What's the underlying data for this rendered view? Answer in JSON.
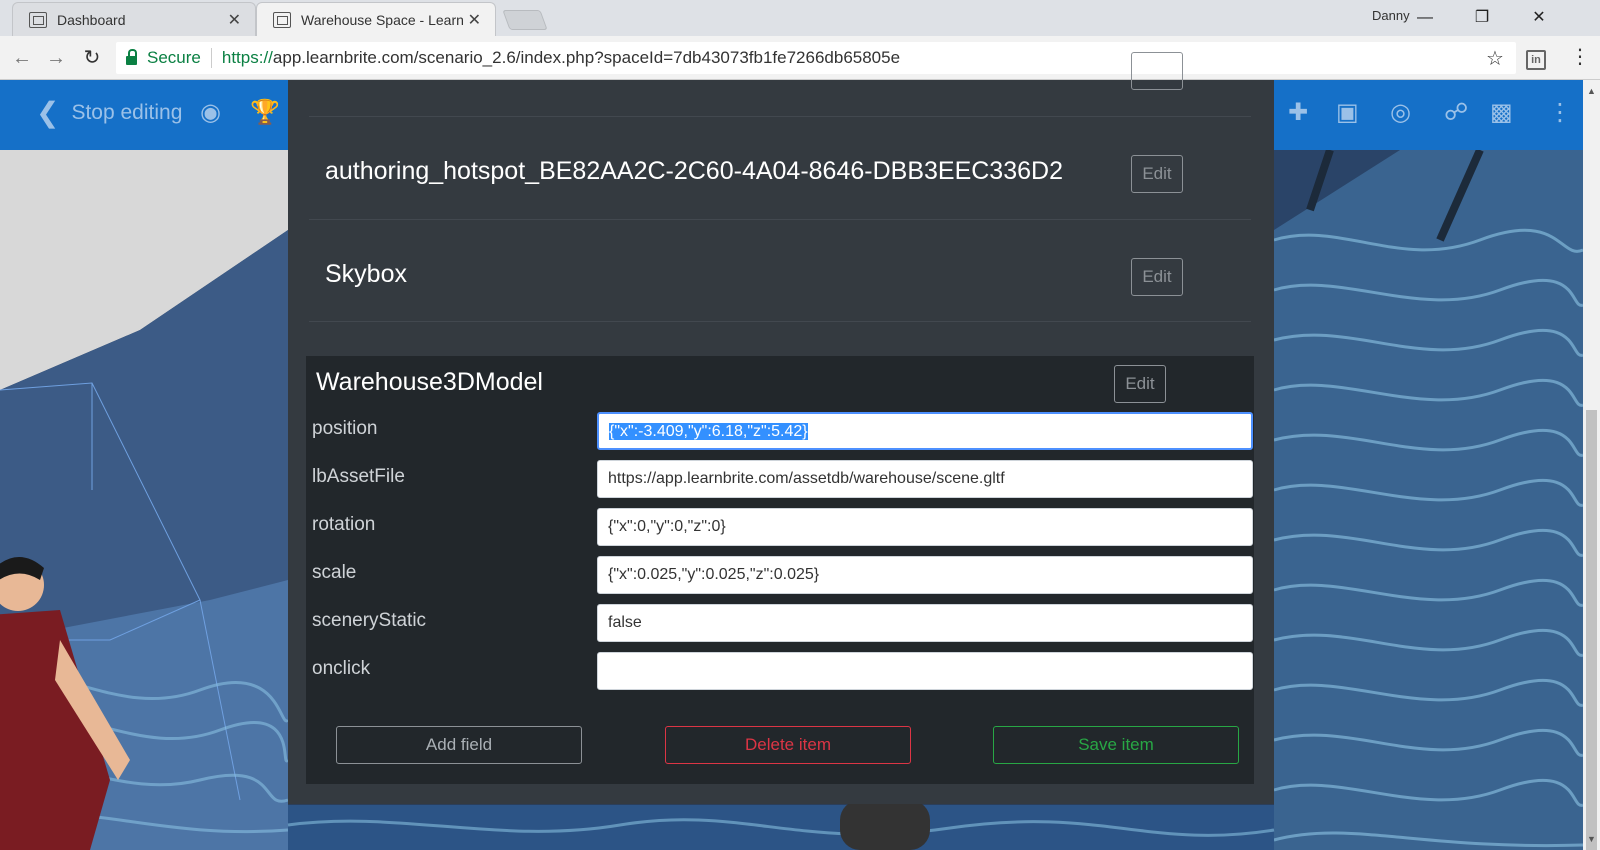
{
  "browser": {
    "tabs": [
      {
        "label": "Dashboard",
        "close": "✕"
      },
      {
        "label": "Warehouse Space - Learn",
        "close": "✕"
      }
    ],
    "profile_name": "Danny",
    "address": {
      "secure_label": "Secure",
      "url_scheme": "https://",
      "url_rest": "app.learnbrite.com/scenario_2.6/index.php?spaceId=7db43073fb1fe7266db65805e"
    },
    "extension_label": "in"
  },
  "toolbar": {
    "stop_editing_label": "Stop editing"
  },
  "items": [
    {
      "title": "authoring_hotspot_BE82AA2C-2C60-4A04-8646-DBB3EEC336D2",
      "edit_label": "Edit"
    },
    {
      "title": "Skybox",
      "edit_label": "Edit"
    }
  ],
  "expanded_item": {
    "title": "Warehouse3DModel",
    "edit_label": "Edit",
    "fields": [
      {
        "label": "position",
        "value": "{\"x\":-3.409,\"y\":6.18,\"z\":5.42}"
      },
      {
        "label": "lbAssetFile",
        "value": "https://app.learnbrite.com/assetdb/warehouse/scene.gltf"
      },
      {
        "label": "rotation",
        "value": "{\"x\":0,\"y\":0,\"z\":0}"
      },
      {
        "label": "scale",
        "value": "{\"x\":0.025,\"y\":0.025,\"z\":0.025}"
      },
      {
        "label": "sceneryStatic",
        "value": "false"
      },
      {
        "label": "onclick",
        "value": ""
      }
    ],
    "actions": {
      "add_label": "Add field",
      "delete_label": "Delete item",
      "save_label": "Save item"
    }
  },
  "colors": {
    "toolbar": "#1570c8",
    "panel": "#343a40",
    "danger": "#dc3545",
    "success": "#28a745"
  }
}
